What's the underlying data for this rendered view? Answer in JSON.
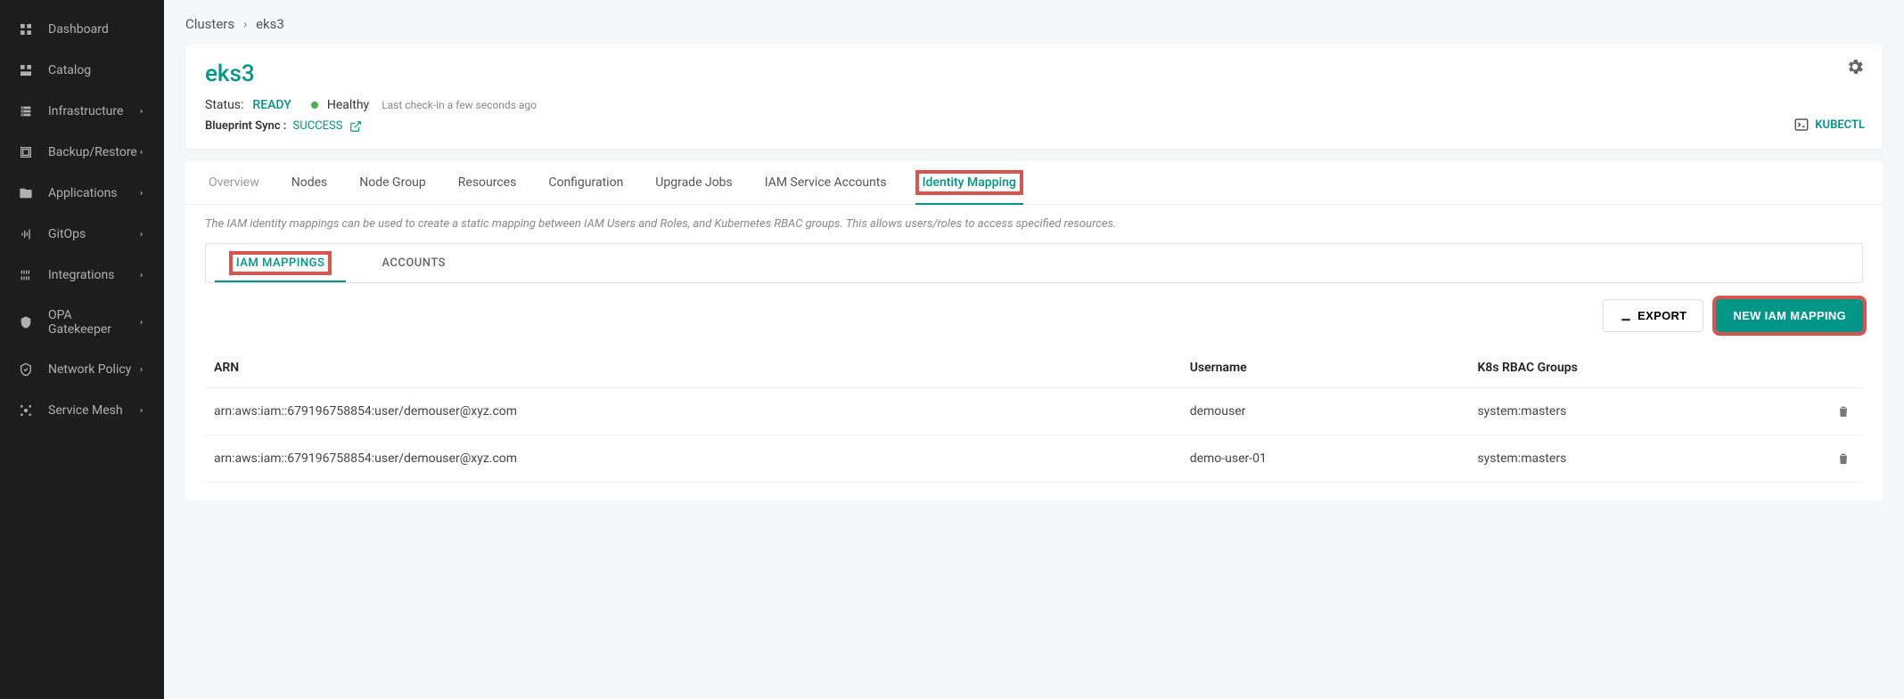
{
  "sidebar": {
    "items": [
      {
        "label": "Dashboard",
        "icon": "dashboard",
        "expandable": false
      },
      {
        "label": "Catalog",
        "icon": "catalog",
        "expandable": false
      },
      {
        "label": "Infrastructure",
        "icon": "infrastructure",
        "expandable": true
      },
      {
        "label": "Backup/Restore",
        "icon": "backup",
        "expandable": true
      },
      {
        "label": "Applications",
        "icon": "applications",
        "expandable": true
      },
      {
        "label": "GitOps",
        "icon": "gitops",
        "expandable": true
      },
      {
        "label": "Integrations",
        "icon": "integrations",
        "expandable": true
      },
      {
        "label": "OPA Gatekeeper",
        "icon": "shield",
        "expandable": true
      },
      {
        "label": "Network Policy",
        "icon": "network",
        "expandable": true
      },
      {
        "label": "Service Mesh",
        "icon": "mesh",
        "expandable": true
      }
    ]
  },
  "breadcrumb": {
    "root": "Clusters",
    "sep": "›",
    "current": "eks3"
  },
  "header": {
    "title": "eks3",
    "status_label": "Status:",
    "status_value": "READY",
    "health_text": "Healthy",
    "checkin_text": "Last check-in a few seconds ago",
    "blueprint_label": "Blueprint Sync :",
    "blueprint_value": "SUCCESS",
    "kubectl_label": "KUBECTL"
  },
  "tabs": [
    {
      "label": "Overview",
      "active": false,
      "muted": true
    },
    {
      "label": "Nodes",
      "active": false
    },
    {
      "label": "Node Group",
      "active": false
    },
    {
      "label": "Resources",
      "active": false
    },
    {
      "label": "Configuration",
      "active": false
    },
    {
      "label": "Upgrade Jobs",
      "active": false
    },
    {
      "label": "IAM Service Accounts",
      "active": false
    },
    {
      "label": "Identity Mapping",
      "active": true,
      "highlight": true
    }
  ],
  "description": "The IAM identity mappings can be used to create a static mapping between IAM Users and Roles, and Kubernetes RBAC groups. This allows users/roles to access specified resources.",
  "subtabs": [
    {
      "label": "IAM MAPPINGS",
      "active": true,
      "highlight": true
    },
    {
      "label": "ACCOUNTS",
      "active": false
    }
  ],
  "actions": {
    "export_label": "EXPORT",
    "new_label": "NEW IAM MAPPING"
  },
  "table": {
    "headers": [
      "ARN",
      "Username",
      "K8s RBAC Groups",
      ""
    ],
    "rows": [
      {
        "arn": "arn:aws:iam::679196758854:user/demouser@xyz.com",
        "username": "demouser",
        "groups": "system:masters"
      },
      {
        "arn": "arn:aws:iam::679196758854:user/demouser@xyz.com",
        "username": "demo-user-01",
        "groups": "system:masters"
      }
    ]
  }
}
